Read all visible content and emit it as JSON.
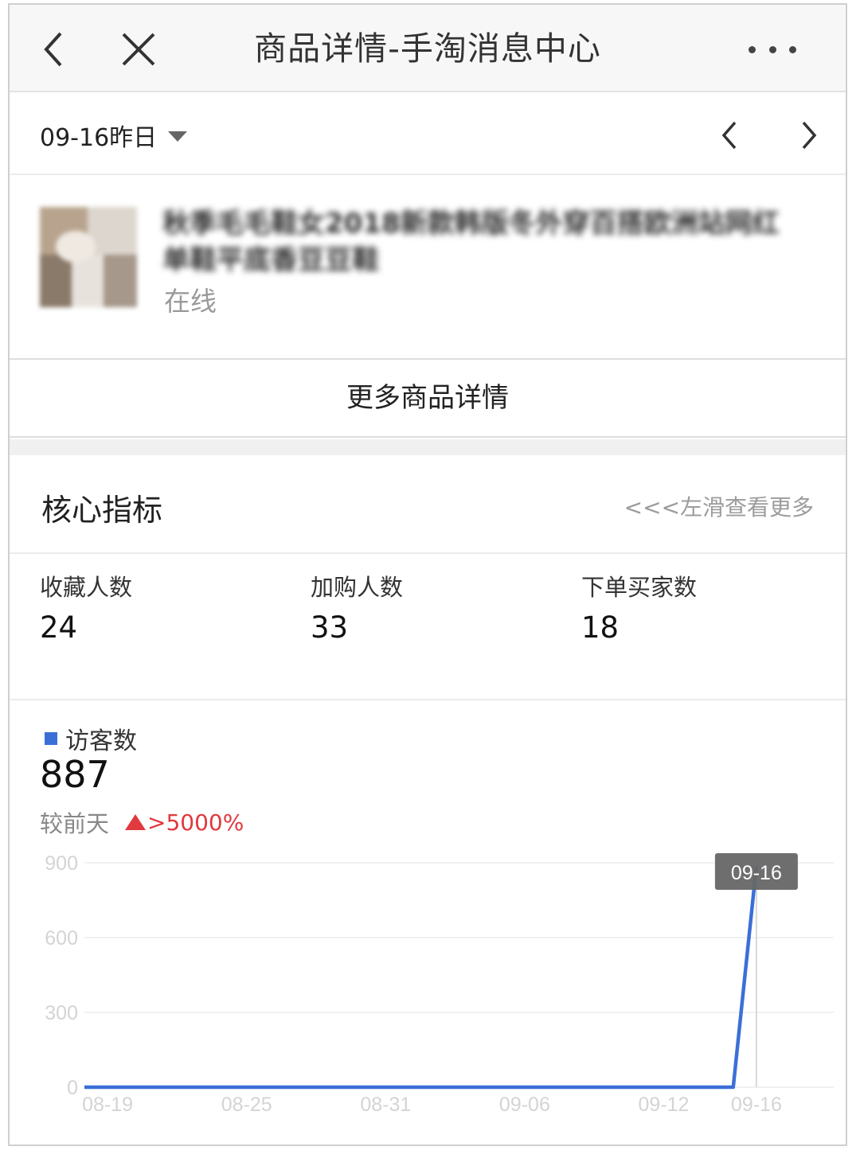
{
  "nav": {
    "title": "商品详情-手淘消息中心",
    "back_icon": "chevron-left-icon",
    "close_icon": "close-icon",
    "more_icon": "more-dots-icon"
  },
  "date_bar": {
    "selected": "09-16昨日",
    "prev_icon": "chevron-left-icon",
    "next_icon": "chevron-right-icon"
  },
  "product": {
    "title": "秋季毛毛鞋女2018新款韩版冬外穿百搭欧洲站网红单鞋平底香豆豆鞋",
    "status": "在线"
  },
  "more_details": {
    "label": "更多商品详情"
  },
  "core_metrics": {
    "title": "核心指标",
    "hint": "<<<左滑查看更多",
    "items": [
      {
        "label": "收藏人数",
        "value": "24"
      },
      {
        "label": "加购人数",
        "value": "33"
      },
      {
        "label": "下单买家数",
        "value": "18"
      }
    ]
  },
  "visitors": {
    "legend": "访客数",
    "value": "887",
    "compare_label": "较前天",
    "change": ">5000%",
    "tooltip": "09-16"
  },
  "colors": {
    "line": "#3b6fd8",
    "up": "#e0393e",
    "tooltip_bg": "#666666"
  },
  "chart_data": {
    "type": "line",
    "title": "",
    "xlabel": "",
    "ylabel": "",
    "ylim": [
      0,
      900
    ],
    "yticks": [
      "900",
      "600",
      "300",
      "0"
    ],
    "xticks": [
      "08-19",
      "08-25",
      "08-31",
      "09-06",
      "09-12",
      "09-16"
    ],
    "x": [
      "08-18",
      "08-19",
      "08-20",
      "08-21",
      "08-22",
      "08-23",
      "08-24",
      "08-25",
      "08-26",
      "08-27",
      "08-28",
      "08-29",
      "08-30",
      "08-31",
      "09-01",
      "09-02",
      "09-03",
      "09-04",
      "09-05",
      "09-06",
      "09-07",
      "09-08",
      "09-09",
      "09-10",
      "09-11",
      "09-12",
      "09-13",
      "09-14",
      "09-15",
      "09-16"
    ],
    "series": [
      {
        "values": [
          0,
          0,
          0,
          0,
          0,
          0,
          0,
          0,
          0,
          0,
          0,
          0,
          0,
          0,
          0,
          0,
          0,
          0,
          0,
          0,
          0,
          0,
          0,
          0,
          0,
          0,
          0,
          0,
          0,
          887
        ]
      }
    ],
    "grid": true,
    "legend": "top-left"
  }
}
